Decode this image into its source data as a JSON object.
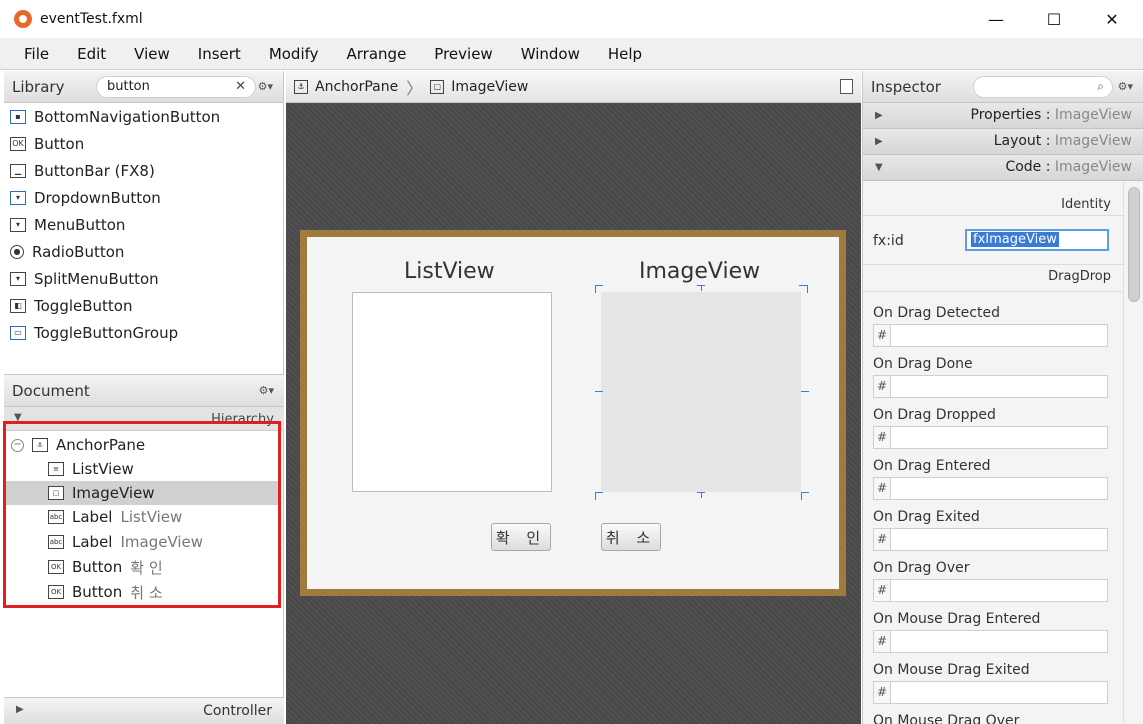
{
  "window": {
    "title": "eventTest.fxml",
    "min": "—",
    "max": "☐",
    "close": "✕"
  },
  "menu": [
    "File",
    "Edit",
    "View",
    "Insert",
    "Modify",
    "Arrange",
    "Preview",
    "Window",
    "Help"
  ],
  "library": {
    "title": "Library",
    "search_value": "button",
    "clear": "✕",
    "items": [
      {
        "label": "BottomNavigationButton",
        "icon": "bottom-nav-icon"
      },
      {
        "label": "Button",
        "icon": "ok-button-icon"
      },
      {
        "label": "ButtonBar  (FX8)",
        "icon": "button-bar-icon"
      },
      {
        "label": "DropdownButton",
        "icon": "dropdown-icon"
      },
      {
        "label": "MenuButton",
        "icon": "menu-button-icon"
      },
      {
        "label": "RadioButton",
        "icon": "radio-icon"
      },
      {
        "label": "SplitMenuButton",
        "icon": "split-menu-icon"
      },
      {
        "label": "ToggleButton",
        "icon": "toggle-icon"
      },
      {
        "label": "ToggleButtonGroup",
        "icon": "toggle-group-icon"
      }
    ]
  },
  "document": {
    "title": "Document",
    "hierarchy": "Hierarchy",
    "controller": "Controller",
    "tree": [
      {
        "label": "AnchorPane",
        "sub": ""
      },
      {
        "label": "ListView",
        "sub": ""
      },
      {
        "label": "ImageView",
        "sub": ""
      },
      {
        "label": "Label",
        "sub": "ListView"
      },
      {
        "label": "Label",
        "sub": "ImageView"
      },
      {
        "label": "Button",
        "sub": "확  인"
      },
      {
        "label": "Button",
        "sub": "취  소"
      }
    ]
  },
  "breadcrumb": {
    "root": "AnchorPane",
    "current": "ImageView"
  },
  "canvas": {
    "label_list": "ListView",
    "label_image": "ImageView",
    "btn_ok": "확 인",
    "btn_cancel": "취 소"
  },
  "inspector": {
    "title": "Inspector",
    "sections": [
      {
        "name": "Properties",
        "sub": "ImageView",
        "expanded": false
      },
      {
        "name": "Layout",
        "sub": "ImageView",
        "expanded": false
      },
      {
        "name": "Code",
        "sub": "ImageView",
        "expanded": true
      }
    ],
    "identity": "Identity",
    "fxid_label": "fx:id",
    "fxid_value": "fxImageView",
    "dragdrop": "DragDrop",
    "events": [
      "On Drag Detected",
      "On Drag Done",
      "On Drag Dropped",
      "On Drag Entered",
      "On Drag Exited",
      "On Drag Over",
      "On Mouse Drag Entered",
      "On Mouse Drag Exited",
      "On Mouse Drag Over"
    ],
    "hash": "#"
  },
  "colors": {
    "accent": "#3a7bd5",
    "highlight": "#e02020",
    "anchor_border": "#a07b40"
  }
}
